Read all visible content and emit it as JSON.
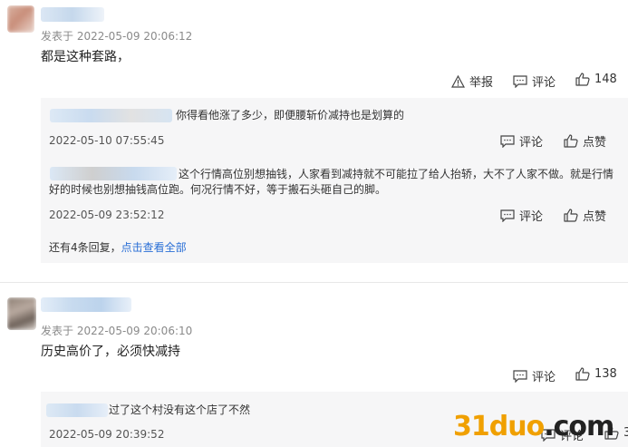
{
  "comments": [
    {
      "meta": "发表于 2022-05-09 20:06:12",
      "text": "都是这种套路，",
      "report_label": "举报",
      "comment_label": "评论",
      "like_count": "148",
      "replies": [
        {
          "text": "你得看他涨了多少，即便腰斩价减持也是划算的",
          "time": "2022-05-10 07:55:45",
          "comment_label": "评论",
          "like_label": "点赞"
        },
        {
          "text": "这个行情高位别想抽钱，人家看到减持就不可能拉了给人抬轿，大不了人家不做。就是行情好的时候也别想抽钱高位跑。何况行情不好，等于搬石头砸自己的脚。",
          "time": "2022-05-09 23:52:12",
          "comment_label": "评论",
          "like_label": "点赞"
        }
      ],
      "more_count": "还有4条回复，",
      "view_all": "点击查看全部"
    },
    {
      "meta": "发表于 2022-05-09 20:06:10",
      "text": "历史高价了，必须快减持",
      "comment_label": "评论",
      "like_count": "138",
      "replies": [
        {
          "text": "过了这个村没有这个店了不然",
          "time": "2022-05-09 20:39:52",
          "comment_label": "评论",
          "like_count": "3"
        }
      ]
    }
  ],
  "watermark": {
    "prefix": "31duo",
    "suffix": ".com",
    "prefix_color": "#f0a000",
    "suffix_color": "#222222"
  }
}
